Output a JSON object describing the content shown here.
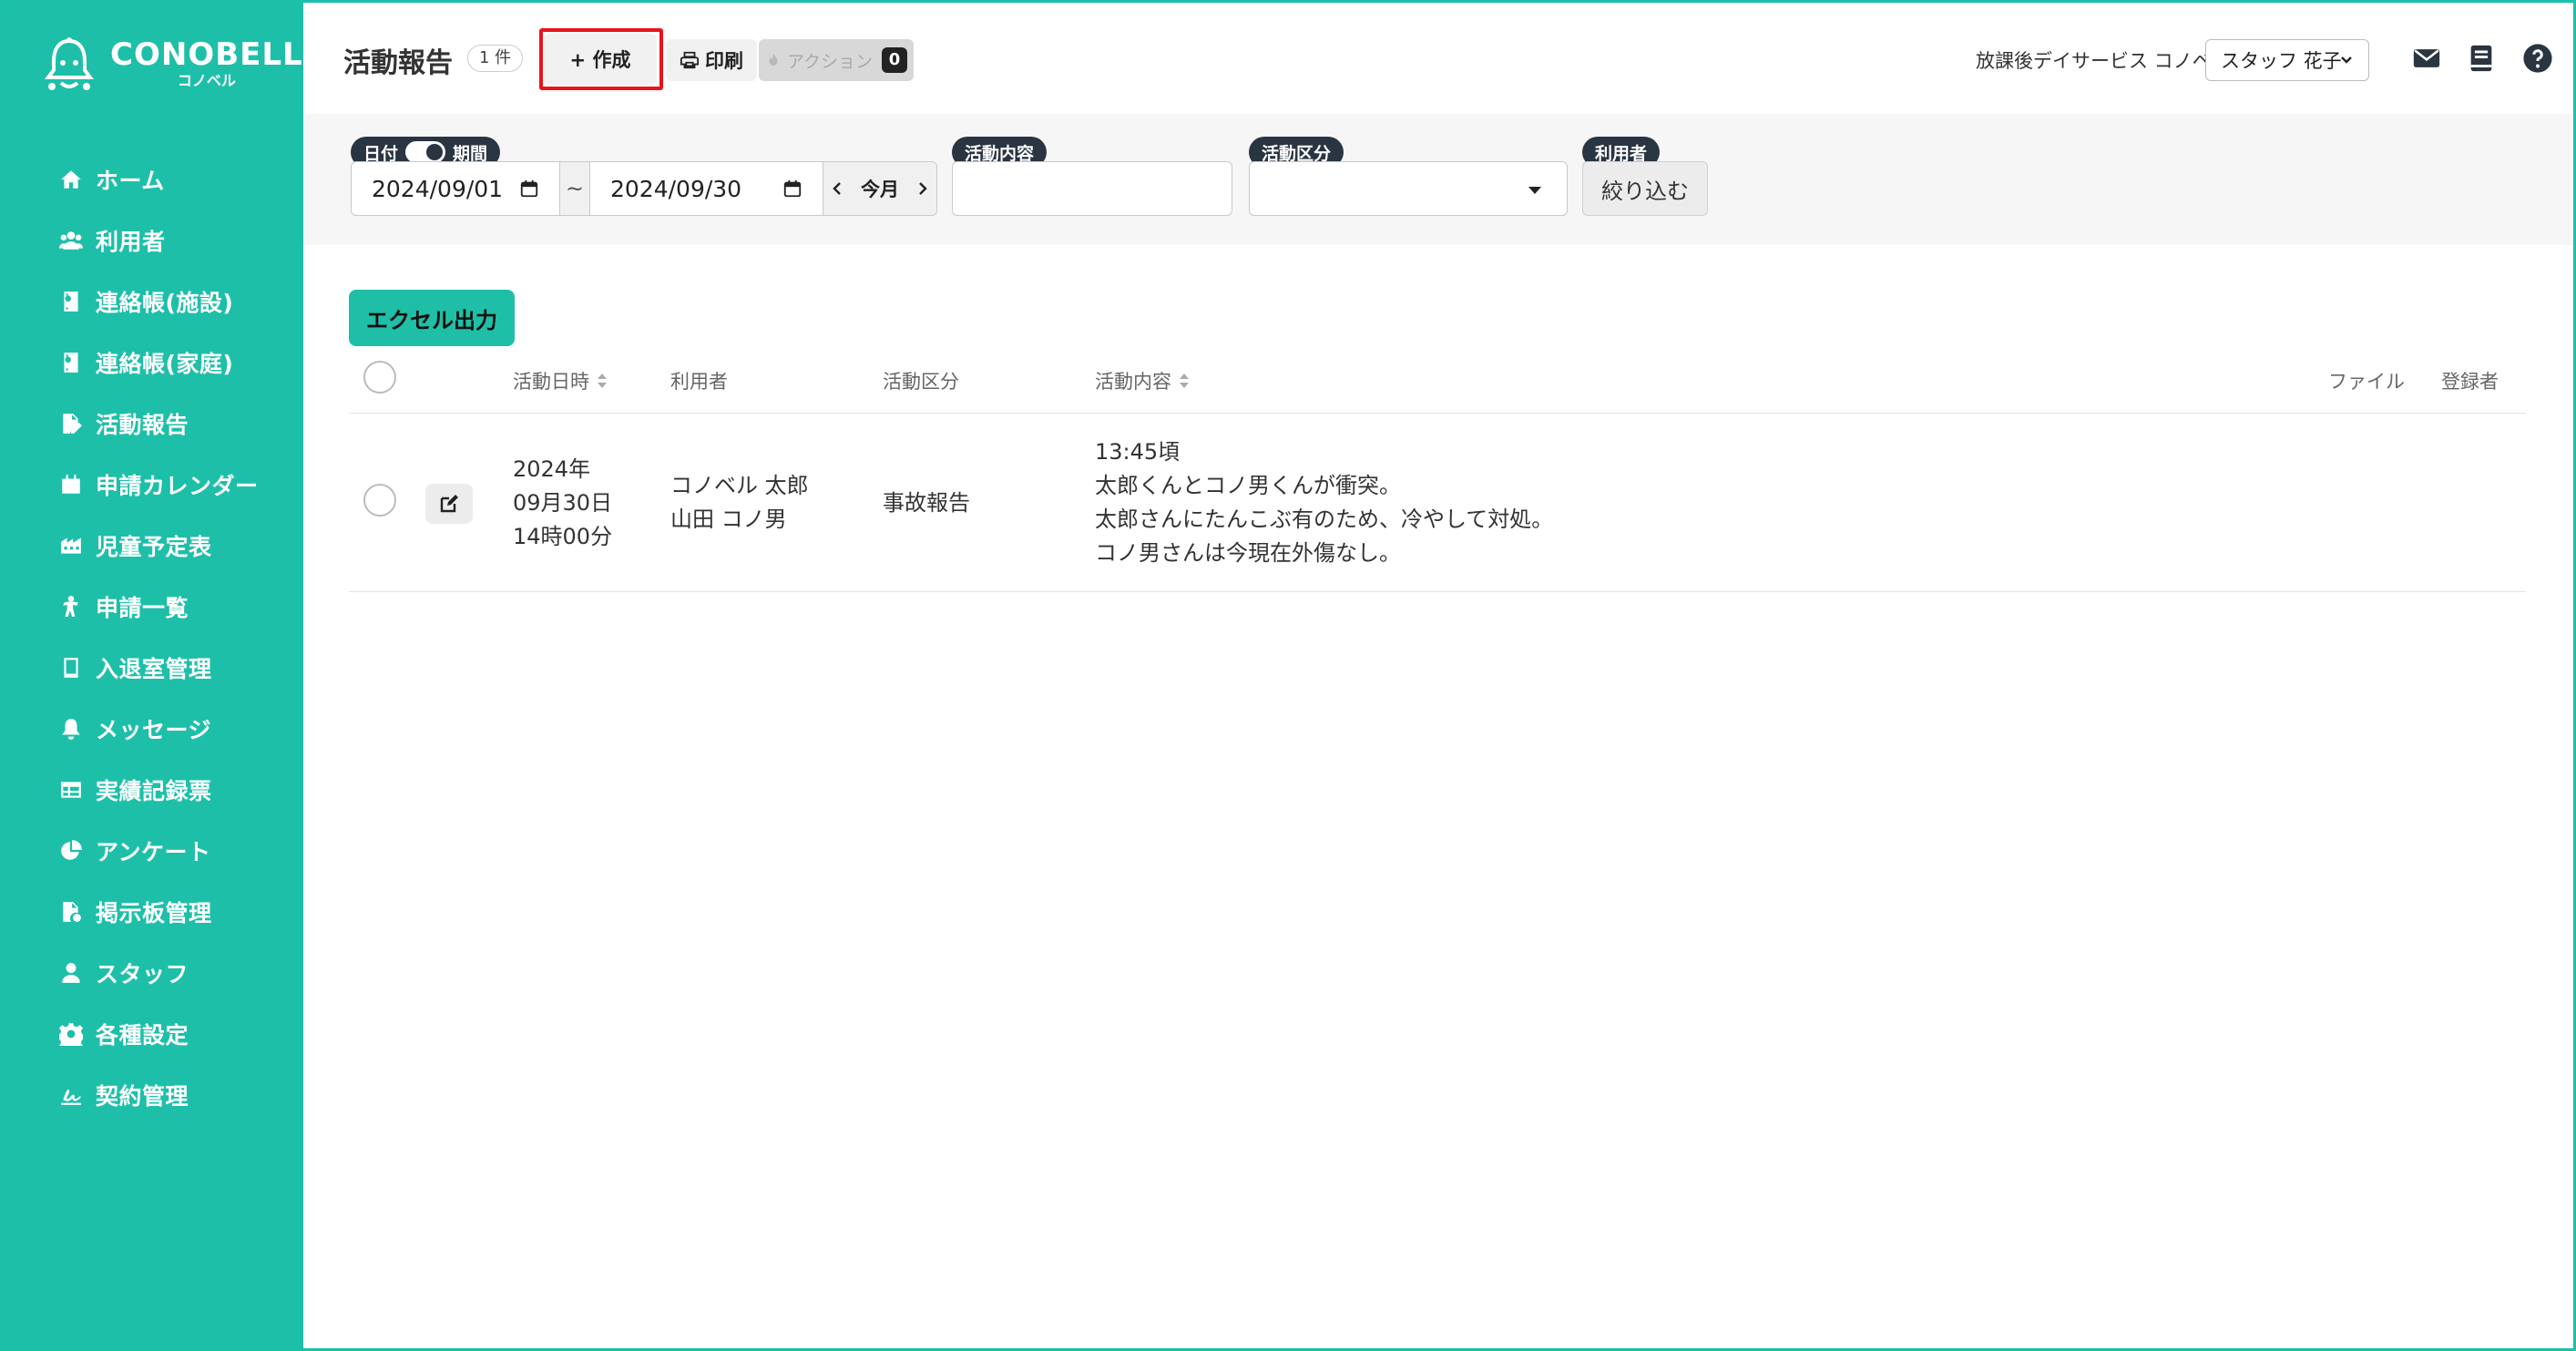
{
  "app": {
    "logo_title": "CONOBELL",
    "logo_sub": "コノベル"
  },
  "sidebar": {
    "items": [
      {
        "label": "ホーム",
        "icon": "home-icon"
      },
      {
        "label": "利用者",
        "icon": "users-icon"
      },
      {
        "label": "連絡帳(施設)",
        "icon": "contact-book-icon"
      },
      {
        "label": "連絡帳(家庭)",
        "icon": "contact-book-icon"
      },
      {
        "label": "活動報告",
        "icon": "report-edit-icon"
      },
      {
        "label": "申請カレンダー",
        "icon": "calendar-icon"
      },
      {
        "label": "児童予定表",
        "icon": "schedule-icon"
      },
      {
        "label": "申請一覧",
        "icon": "child-icon"
      },
      {
        "label": "入退室管理",
        "icon": "tablet-icon"
      },
      {
        "label": "メッセージ",
        "icon": "bell-icon"
      },
      {
        "label": "実績記録票",
        "icon": "table-icon"
      },
      {
        "label": "アンケート",
        "icon": "pie-chart-icon"
      },
      {
        "label": "掲示板管理",
        "icon": "bulletin-icon"
      },
      {
        "label": "スタッフ",
        "icon": "staff-icon"
      },
      {
        "label": "各種設定",
        "icon": "gear-icon"
      },
      {
        "label": "契約管理",
        "icon": "signature-icon"
      }
    ]
  },
  "header": {
    "title": "活動報告",
    "count": "1 件",
    "create_label": "+ 作成",
    "print_label": "印刷",
    "action_label": "アクション",
    "action_count": "0",
    "facility": "放課後デイサービス コノベル",
    "staff": "スタッフ 花子"
  },
  "filters": {
    "date_label": "日付",
    "period_label": "期間",
    "date_from": "2024/09/01",
    "tilde": "~",
    "date_to": "2024/09/30",
    "this_month": "今月",
    "content_label": "活動内容",
    "category_label": "活動区分",
    "user_label": "利用者",
    "filter_button": "絞り込む"
  },
  "table": {
    "excel_button": "エクセル出力",
    "headers": {
      "date": "活動日時",
      "user": "利用者",
      "category": "活動区分",
      "content": "活動内容",
      "file": "ファイル",
      "registrant": "登録者"
    },
    "rows": [
      {
        "date_lines": [
          "2024年",
          "09月30日",
          "14時00分"
        ],
        "user_lines": [
          "コノベル 太郎",
          "山田 コノ男"
        ],
        "category": "事故報告",
        "content_lines": [
          "13:45頃",
          "太郎くんとコノ男くんが衝突。",
          "太郎さんにたんこぶ有のため、冷やして対処。",
          "コノ男さんは今現在外傷なし。"
        ],
        "file": "",
        "registrant": ""
      }
    ]
  },
  "colors": {
    "sidebar": "#1ebfa9",
    "highlight": "#e8141c",
    "pill": "#2a3542"
  }
}
